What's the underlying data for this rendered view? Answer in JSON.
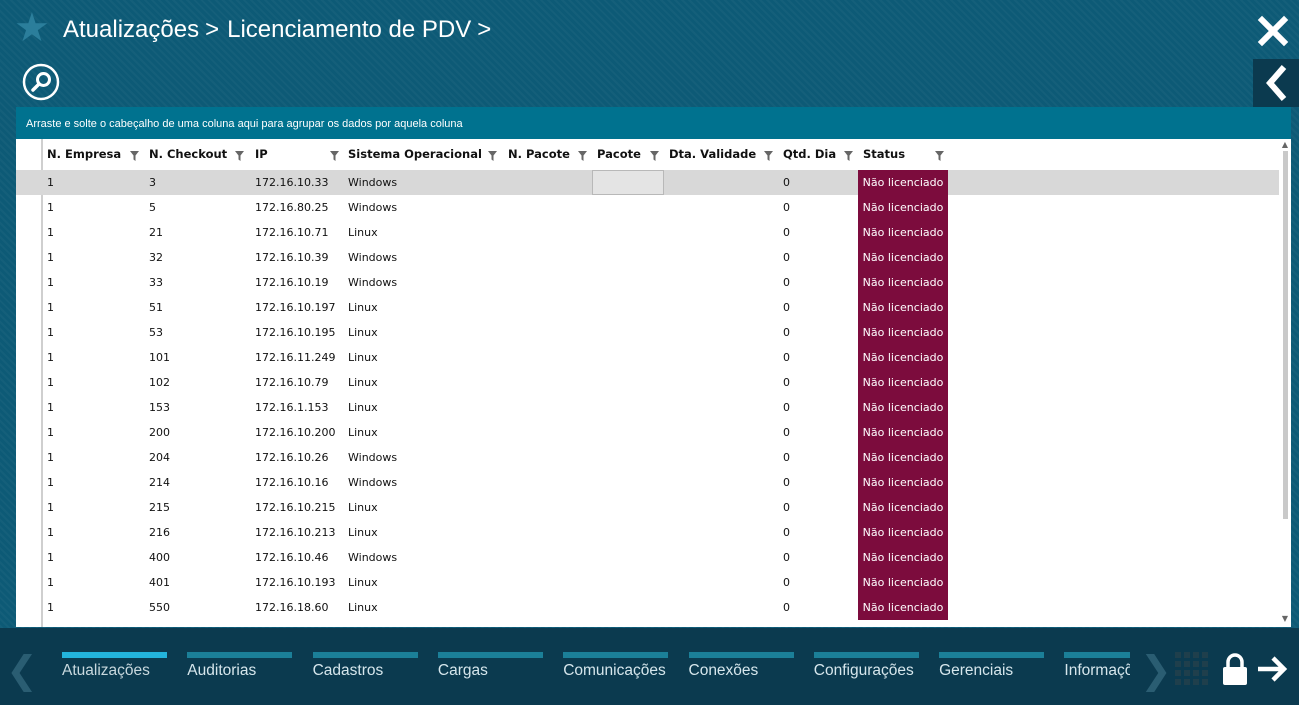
{
  "header": {
    "breadcrumb": [
      "Atualizações",
      "Licenciamento de PDV"
    ],
    "separator": ">"
  },
  "grid": {
    "group_hint": "Arraste e solte o cabeçalho de uma coluna aqui para agrupar os dados por aquela coluna",
    "columns": [
      "N. Empresa",
      "N. Checkout",
      "IP",
      "Sistema Operacional",
      "N. Pacote",
      "Pacote",
      "Dta. Validade",
      "Qtd. Dia",
      "Status"
    ],
    "rows": [
      {
        "empresa": "1",
        "checkout": "3",
        "ip": "172.16.10.33",
        "so": "Windows",
        "qtd": "0",
        "status": "Não licenciado"
      },
      {
        "empresa": "1",
        "checkout": "5",
        "ip": "172.16.80.25",
        "so": "Windows",
        "qtd": "0",
        "status": "Não licenciado"
      },
      {
        "empresa": "1",
        "checkout": "21",
        "ip": "172.16.10.71",
        "so": "Linux",
        "qtd": "0",
        "status": "Não licenciado"
      },
      {
        "empresa": "1",
        "checkout": "32",
        "ip": "172.16.10.39",
        "so": "Windows",
        "qtd": "0",
        "status": "Não licenciado"
      },
      {
        "empresa": "1",
        "checkout": "33",
        "ip": "172.16.10.19",
        "so": "Windows",
        "qtd": "0",
        "status": "Não licenciado"
      },
      {
        "empresa": "1",
        "checkout": "51",
        "ip": "172.16.10.197",
        "so": "Linux",
        "qtd": "0",
        "status": "Não licenciado"
      },
      {
        "empresa": "1",
        "checkout": "53",
        "ip": "172.16.10.195",
        "so": "Linux",
        "qtd": "0",
        "status": "Não licenciado"
      },
      {
        "empresa": "1",
        "checkout": "101",
        "ip": "172.16.11.249",
        "so": "Linux",
        "qtd": "0",
        "status": "Não licenciado"
      },
      {
        "empresa": "1",
        "checkout": "102",
        "ip": "172.16.10.79",
        "so": "Linux",
        "qtd": "0",
        "status": "Não licenciado"
      },
      {
        "empresa": "1",
        "checkout": "153",
        "ip": "172.16.1.153",
        "so": "Linux",
        "qtd": "0",
        "status": "Não licenciado"
      },
      {
        "empresa": "1",
        "checkout": "200",
        "ip": "172.16.10.200",
        "so": "Linux",
        "qtd": "0",
        "status": "Não licenciado"
      },
      {
        "empresa": "1",
        "checkout": "204",
        "ip": "172.16.10.26",
        "so": "Windows",
        "qtd": "0",
        "status": "Não licenciado"
      },
      {
        "empresa": "1",
        "checkout": "214",
        "ip": "172.16.10.16",
        "so": "Windows",
        "qtd": "0",
        "status": "Não licenciado"
      },
      {
        "empresa": "1",
        "checkout": "215",
        "ip": "172.16.10.215",
        "so": "Linux",
        "qtd": "0",
        "status": "Não licenciado"
      },
      {
        "empresa": "1",
        "checkout": "216",
        "ip": "172.16.10.213",
        "so": "Linux",
        "qtd": "0",
        "status": "Não licenciado"
      },
      {
        "empresa": "1",
        "checkout": "400",
        "ip": "172.16.10.46",
        "so": "Windows",
        "qtd": "0",
        "status": "Não licenciado"
      },
      {
        "empresa": "1",
        "checkout": "401",
        "ip": "172.16.10.193",
        "so": "Linux",
        "qtd": "0",
        "status": "Não licenciado"
      },
      {
        "empresa": "1",
        "checkout": "550",
        "ip": "172.16.18.60",
        "so": "Linux",
        "qtd": "0",
        "status": "Não licenciado"
      }
    ]
  },
  "bottom_nav": {
    "tabs": [
      "Atualizações",
      "Auditorias",
      "Cadastros",
      "Cargas",
      "Comunicações",
      "Conexões",
      "Configurações",
      "Gerenciais",
      "Informações"
    ],
    "active_tab": "Atualizações"
  },
  "icons": {
    "favorite": "star-icon",
    "close": "close-icon",
    "search": "search-icon",
    "back": "chevron-left-icon",
    "column_filter": "funnel-icon",
    "apps": "grid-icon",
    "lock": "lock-icon",
    "logout": "arrow-right-icon"
  },
  "colors": {
    "background": "#0d5a76",
    "group_bar": "#00728f",
    "status_unlicensed": "#7c0c3d",
    "selected_row": "#d8d8d8",
    "bottom_bar": "#0b3a4f",
    "tab_bar": "#1b7f98",
    "tab_bar_active": "#23b4dc"
  }
}
